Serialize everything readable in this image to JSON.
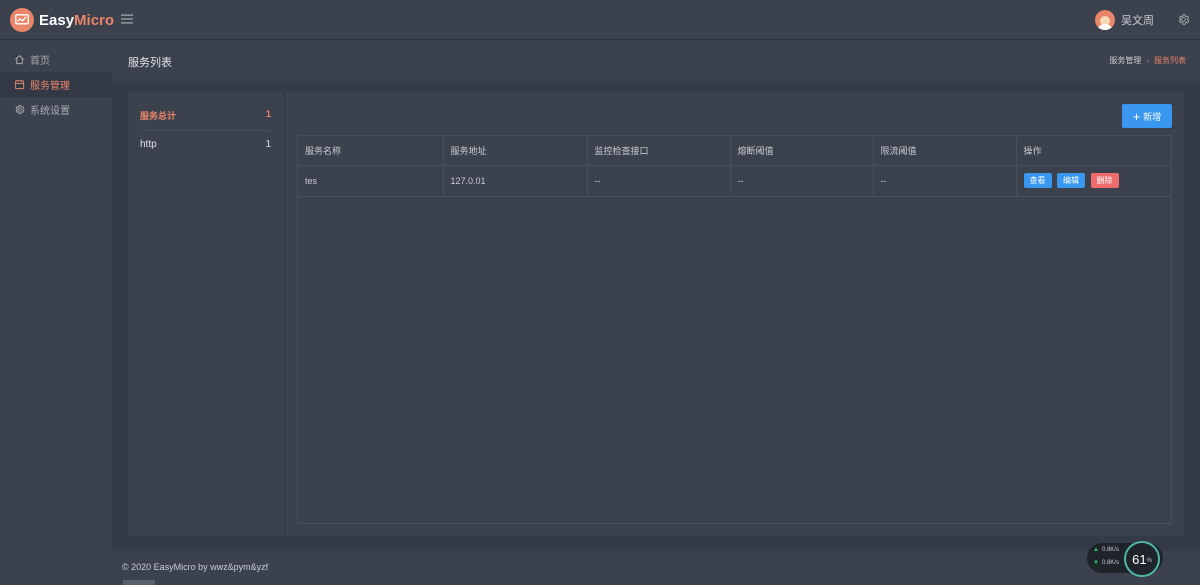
{
  "app": {
    "logo_text_main": "Easy",
    "logo_text_accent": "Micro",
    "user_name": "吴文周"
  },
  "sidebar": {
    "items": [
      {
        "label": "首页",
        "icon": "home-icon",
        "active": false
      },
      {
        "label": "服务管理",
        "icon": "calendar-icon",
        "active": true
      },
      {
        "label": "系统设置",
        "icon": "gear-icon",
        "active": false
      }
    ]
  },
  "content_header": {
    "title": "服务列表",
    "breadcrumb": [
      "服务管理",
      "服务列表"
    ]
  },
  "stats": {
    "total_label": "服务总计",
    "total_count": "1",
    "types": [
      {
        "label": "http",
        "count": "1"
      }
    ]
  },
  "toolbar": {
    "add_label": "新增"
  },
  "table": {
    "columns": [
      "服务名称",
      "服务地址",
      "监控检查接口",
      "熔断阈值",
      "限流阈值",
      "操作"
    ],
    "rows": [
      {
        "name": "tes",
        "address": "127.0.01",
        "health_check": "--",
        "circuit_threshold": "--",
        "rate_threshold": "--"
      }
    ],
    "actions": {
      "view": "查看",
      "edit": "编辑",
      "delete": "删除"
    }
  },
  "footer": {
    "copyright": "© 2020 EasyMicro by wwz&pym&yzf"
  },
  "speed_widget": {
    "upload": "0.8",
    "download": "0.8",
    "unit": "K/s",
    "percent": "61",
    "percent_unit": "%"
  },
  "colors": {
    "accent": "#e9866a",
    "primary": "#3a97ef",
    "danger": "#ef6b6b",
    "background": "#343a46",
    "surface": "#3b414d"
  }
}
